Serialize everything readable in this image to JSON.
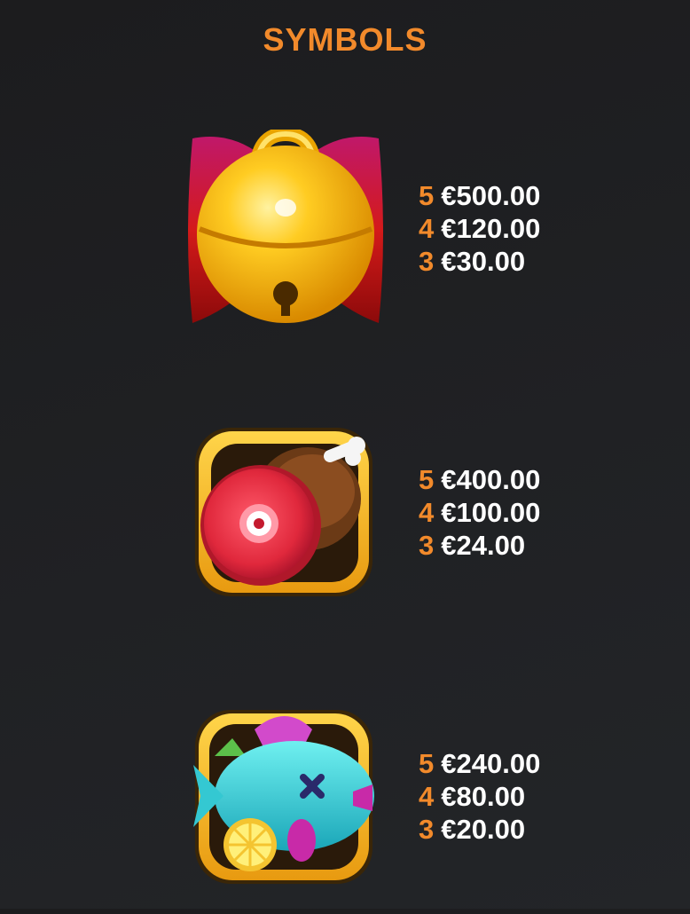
{
  "title": "SYMBOLS",
  "colors": {
    "accent": "#f28a2b",
    "text": "#ffffff",
    "background": "#1f2022"
  },
  "symbols": [
    {
      "icon": "golden-bell-with-red-bow-icon",
      "payouts": [
        {
          "count": "5",
          "amount": "€500.00"
        },
        {
          "count": "4",
          "amount": "€120.00"
        },
        {
          "count": "3",
          "amount": "€30.00"
        }
      ]
    },
    {
      "icon": "ham-leg-icon",
      "payouts": [
        {
          "count": "5",
          "amount": "€400.00"
        },
        {
          "count": "4",
          "amount": "€100.00"
        },
        {
          "count": "3",
          "amount": "€24.00"
        }
      ]
    },
    {
      "icon": "fish-dish-with-lemon-icon",
      "payouts": [
        {
          "count": "5",
          "amount": "€240.00"
        },
        {
          "count": "4",
          "amount": "€80.00"
        },
        {
          "count": "3",
          "amount": "€20.00"
        }
      ]
    }
  ]
}
